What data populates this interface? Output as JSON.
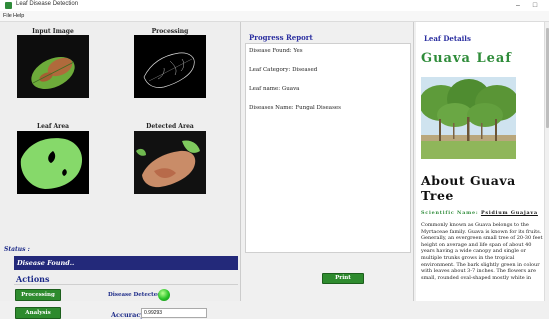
{
  "window": {
    "title": "Leaf Disease Detection",
    "minimize_glyph": "–",
    "maximize_glyph": "□"
  },
  "menu": {
    "items": [
      "File",
      "Help"
    ]
  },
  "left": {
    "images": [
      {
        "label": "Input Image"
      },
      {
        "label": "Processing"
      },
      {
        "label": "Leaf Area"
      },
      {
        "label": "Detected Area"
      }
    ],
    "status_label": "Status :",
    "status_text": "Disease Found..",
    "actions_label": "Actions",
    "processing_button": "Processing",
    "analysis_button": "Analysis",
    "detected_label": "Disease Detected",
    "accuracy_label": "Accuracy:",
    "accuracy_value": "0.99293"
  },
  "report": {
    "title": "Progress Report",
    "lines": [
      "Disease Found: Yes",
      "Leaf Category: Diseased",
      "Leaf name: Guava",
      "Diseases Name: Fungal Diseases"
    ],
    "print_button": "Print"
  },
  "details": {
    "title": "Leaf Details",
    "leaf_name": "Guava Leaf",
    "about_heading": "About Guava Tree",
    "scientific_label": "Scientific Name:",
    "scientific_value": "Psidium Guajava",
    "description": "Commonly known as Guava belongs to the Myrtaceae family. Guava is known for its fruits. Generally, an evergreen small tree of 20-30 feet height on average and life span of about 40 years having a wide canopy and single or multiple trunks grows in the tropical environment. The bark slightly green in colour with leaves about 3-7 inches. The flowers are small, rounded oval-shaped mostly white in"
  },
  "colors": {
    "accent_blue": "#2b2fa0",
    "status_bar": "#23297a",
    "button_green": "#2e8b2e",
    "leaf_title_green": "#2f8c3a",
    "indicator_green": "#27c227"
  }
}
